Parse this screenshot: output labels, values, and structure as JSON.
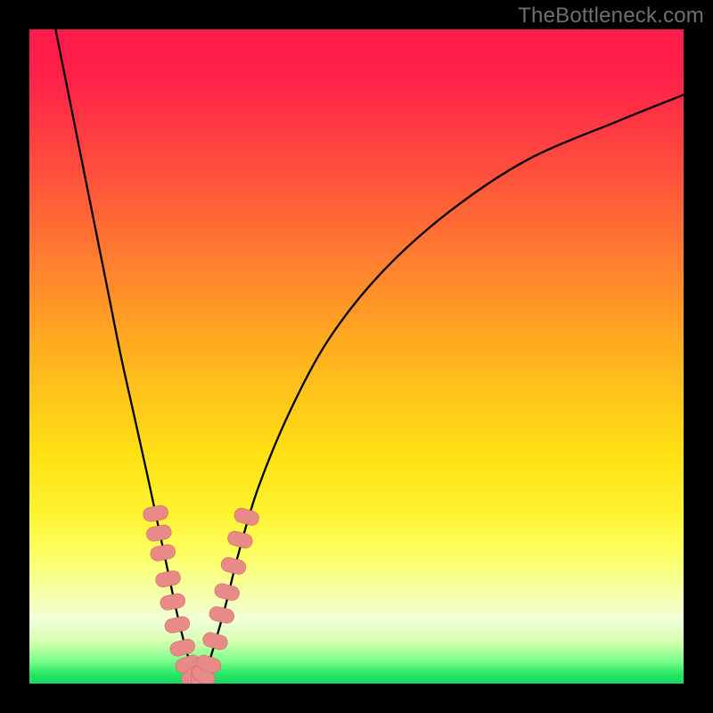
{
  "attribution": "TheBottleneck.com",
  "colors": {
    "black": "#000000",
    "gradient_stops": [
      {
        "offset": 0.0,
        "color": "#ff1a4a"
      },
      {
        "offset": 0.08,
        "color": "#ff2348"
      },
      {
        "offset": 0.2,
        "color": "#ff4a3e"
      },
      {
        "offset": 0.35,
        "color": "#ff7d30"
      },
      {
        "offset": 0.5,
        "color": "#ffb21e"
      },
      {
        "offset": 0.65,
        "color": "#ffe114"
      },
      {
        "offset": 0.74,
        "color": "#fff330"
      },
      {
        "offset": 0.8,
        "color": "#fcff60"
      },
      {
        "offset": 0.86,
        "color": "#f6ffa6"
      },
      {
        "offset": 0.905,
        "color": "#f0ffd8"
      },
      {
        "offset": 0.935,
        "color": "#d7ffb0"
      },
      {
        "offset": 0.965,
        "color": "#7dff8a"
      },
      {
        "offset": 0.985,
        "color": "#27e867"
      },
      {
        "offset": 1.0,
        "color": "#19d65f"
      }
    ],
    "curve": "#000000",
    "marker_fill": "#e88a88",
    "marker_stroke": "#cf6a68"
  },
  "chart_data": {
    "type": "line",
    "title": "",
    "xlabel": "",
    "ylabel": "",
    "note": "decorative bottleneck-style V-curve; numeric axes implied but not labeled",
    "xlim": [
      0,
      100
    ],
    "ylim": [
      0,
      100
    ],
    "series": [
      {
        "name": "bottleneck-curve",
        "x": [
          4,
          6,
          8,
          10,
          12,
          14,
          16,
          18,
          19.5,
          21,
          22.5,
          24,
          25,
          26,
          27,
          28,
          30,
          32,
          35,
          40,
          46,
          54,
          64,
          76,
          90,
          100
        ],
        "y": [
          100,
          90,
          80,
          70,
          60,
          50,
          41,
          32,
          25,
          18,
          11,
          5,
          2,
          0.5,
          2,
          5,
          12,
          20,
          30,
          42,
          53,
          63,
          72,
          80,
          86,
          90
        ]
      }
    ],
    "markers": {
      "name": "highlighted-segment",
      "points": [
        {
          "x": 19.3,
          "y": 26
        },
        {
          "x": 19.8,
          "y": 23
        },
        {
          "x": 20.4,
          "y": 20
        },
        {
          "x": 21.2,
          "y": 16
        },
        {
          "x": 21.9,
          "y": 12.5
        },
        {
          "x": 22.6,
          "y": 9
        },
        {
          "x": 23.4,
          "y": 5.5
        },
        {
          "x": 24.2,
          "y": 3
        },
        {
          "x": 25.0,
          "y": 1.2
        },
        {
          "x": 25.8,
          "y": 0.6
        },
        {
          "x": 26.6,
          "y": 1.2
        },
        {
          "x": 27.4,
          "y": 3
        },
        {
          "x": 28.4,
          "y": 6.5
        },
        {
          "x": 29.4,
          "y": 10.5
        },
        {
          "x": 30.2,
          "y": 14
        },
        {
          "x": 31.2,
          "y": 18
        },
        {
          "x": 32.2,
          "y": 22
        },
        {
          "x": 33.2,
          "y": 25.5
        }
      ]
    }
  }
}
